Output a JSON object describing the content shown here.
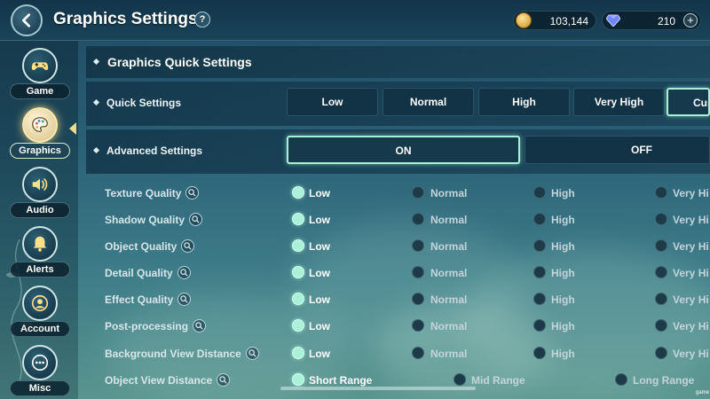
{
  "header": {
    "title": "Graphics Settings",
    "help": "?",
    "currency": {
      "gold": "103,144",
      "gems": "210",
      "plus": "+"
    }
  },
  "sidebar": {
    "items": [
      {
        "label": "Game",
        "icon": "gamepad-icon"
      },
      {
        "label": "Graphics",
        "icon": "palette-icon",
        "active": true
      },
      {
        "label": "Audio",
        "icon": "speaker-icon"
      },
      {
        "label": "Alerts",
        "icon": "bell-icon"
      },
      {
        "label": "Account",
        "icon": "user-icon"
      },
      {
        "label": "Misc",
        "icon": "more-icon"
      }
    ]
  },
  "main": {
    "section_title": "Graphics Quick Settings",
    "quick_settings": {
      "label": "Quick Settings",
      "options": [
        "Low",
        "Normal",
        "High",
        "Very High",
        "Cus"
      ],
      "selected": 4
    },
    "advanced_settings": {
      "label": "Advanced Settings",
      "options": [
        "ON",
        "OFF"
      ],
      "selected": 0
    },
    "quality_levels": [
      "Low",
      "Normal",
      "High",
      "Very Hi"
    ],
    "settings": [
      {
        "label": "Texture Quality",
        "selected": 0
      },
      {
        "label": "Shadow Quality",
        "selected": 0
      },
      {
        "label": "Object Quality",
        "selected": 0
      },
      {
        "label": "Detail Quality",
        "selected": 0
      },
      {
        "label": "Effect Quality",
        "selected": 0
      },
      {
        "label": "Post-processing",
        "selected": 0
      },
      {
        "label": "Background View Distance",
        "selected": 0
      }
    ],
    "view_distance": {
      "label": "Object View Distance",
      "options": [
        "Short Range",
        "Mid Range",
        "Long Range"
      ],
      "selected": 0
    }
  },
  "watermark": "game",
  "colors": {
    "accent": "#a9f1d8",
    "active_tab": "#f1d98a",
    "panel": "#123449"
  }
}
